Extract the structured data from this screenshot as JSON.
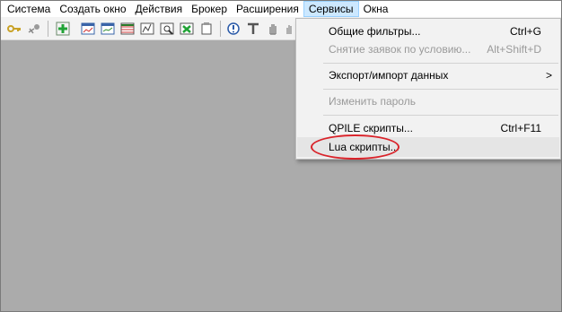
{
  "menubar": {
    "items": [
      {
        "label": "Система"
      },
      {
        "label": "Создать окно"
      },
      {
        "label": "Действия"
      },
      {
        "label": "Брокер"
      },
      {
        "label": "Расширения"
      },
      {
        "label": "Сервисы"
      },
      {
        "label": "Окна"
      }
    ]
  },
  "toolbar": {
    "icons": [
      "key-icon",
      "disconnect-icon",
      "add-window-icon",
      "chart-window-icon",
      "chart-window-2-icon",
      "table-window-icon",
      "quotes-window-icon",
      "search-window-icon",
      "transaction-icon",
      "portfolio-icon",
      "alert-icon",
      "text-icon",
      "hand-icon",
      "drag-icon"
    ]
  },
  "services_menu": {
    "items": [
      {
        "label": "Общие фильтры...",
        "shortcut": "Ctrl+G",
        "enabled": true
      },
      {
        "label": "Снятие заявок по условию...",
        "shortcut": "Alt+Shift+D",
        "enabled": false
      },
      {
        "label": "Экспорт/импорт данных",
        "shortcut": "",
        "submenu_arrow": ">",
        "enabled": true
      },
      {
        "label": "Изменить пароль",
        "shortcut": "",
        "enabled": false
      },
      {
        "label": "QPILE скрипты...",
        "shortcut": "Ctrl+F11",
        "enabled": true
      },
      {
        "label": "Lua скрипты...",
        "shortcut": "",
        "enabled": true,
        "highlighted": true
      }
    ]
  },
  "colors": {
    "menu_active_bg": "#cce8ff",
    "workspace_bg": "#ababab",
    "highlight_ring": "#d9232a"
  }
}
